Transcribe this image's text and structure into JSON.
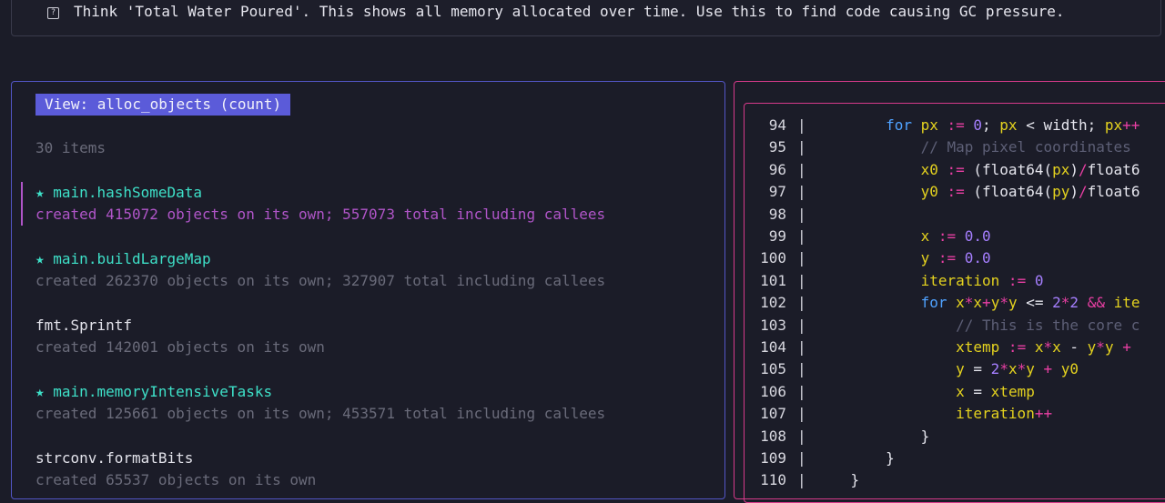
{
  "tip": {
    "icon": "question-square-icon",
    "text": "Think 'Total Water Poured'. This shows all memory allocated over time. Use this to find code causing GC pressure."
  },
  "view": {
    "label": "View: alloc_objects (count)",
    "item_count": "30 items"
  },
  "items": [
    {
      "star": "★",
      "name": "main.hashSomeData",
      "desc": "created 415072 objects on its own; 557073 total including callees",
      "selected": true
    },
    {
      "star": "★",
      "name": "main.buildLargeMap",
      "desc": "created 262370 objects on its own; 327907 total including callees"
    },
    {
      "star": "",
      "name": "fmt.Sprintf",
      "desc": "created 142001 objects on its own"
    },
    {
      "star": "★",
      "name": "main.memoryIntensiveTasks",
      "desc": "created 125661 objects on its own; 453571 total including callees"
    },
    {
      "star": "",
      "name": "strconv.formatBits",
      "desc": "created 65537 objects on its own"
    }
  ],
  "code": {
    "separator": "|",
    "lines": [
      {
        "num": "94",
        "tokens": [
          [
            "pl",
            "        "
          ],
          [
            "kw",
            "for "
          ],
          [
            "id",
            "px"
          ],
          [
            "op",
            " := "
          ],
          [
            "num",
            "0"
          ],
          [
            "pl",
            "; "
          ],
          [
            "id",
            "px"
          ],
          [
            "pl",
            " < "
          ],
          [
            "pl",
            "width"
          ],
          [
            "pl",
            "; "
          ],
          [
            "id",
            "px"
          ],
          [
            "op",
            "++"
          ]
        ]
      },
      {
        "num": "95",
        "tokens": [
          [
            "pl",
            "            "
          ],
          [
            "cm",
            "// Map pixel coordinates "
          ]
        ]
      },
      {
        "num": "96",
        "tokens": [
          [
            "pl",
            "            "
          ],
          [
            "id",
            "x0"
          ],
          [
            "op",
            " := "
          ],
          [
            "pl",
            "("
          ],
          [
            "pl",
            "float64"
          ],
          [
            "pl",
            "("
          ],
          [
            "id",
            "px"
          ],
          [
            "pl",
            ")"
          ],
          [
            "op",
            "/"
          ],
          [
            "pl",
            "float6"
          ]
        ]
      },
      {
        "num": "97",
        "tokens": [
          [
            "pl",
            "            "
          ],
          [
            "id",
            "y0"
          ],
          [
            "op",
            " := "
          ],
          [
            "pl",
            "("
          ],
          [
            "pl",
            "float64"
          ],
          [
            "pl",
            "("
          ],
          [
            "id",
            "py"
          ],
          [
            "pl",
            ")"
          ],
          [
            "op",
            "/"
          ],
          [
            "pl",
            "float6"
          ]
        ]
      },
      {
        "num": "98",
        "tokens": []
      },
      {
        "num": "99",
        "tokens": [
          [
            "pl",
            "            "
          ],
          [
            "id",
            "x"
          ],
          [
            "op",
            " := "
          ],
          [
            "num",
            "0.0"
          ]
        ]
      },
      {
        "num": "100",
        "tokens": [
          [
            "pl",
            "            "
          ],
          [
            "id",
            "y"
          ],
          [
            "op",
            " := "
          ],
          [
            "num",
            "0.0"
          ]
        ]
      },
      {
        "num": "101",
        "tokens": [
          [
            "pl",
            "            "
          ],
          [
            "id",
            "iteration"
          ],
          [
            "op",
            " := "
          ],
          [
            "num",
            "0"
          ]
        ]
      },
      {
        "num": "102",
        "tokens": [
          [
            "pl",
            "            "
          ],
          [
            "kw",
            "for "
          ],
          [
            "id",
            "x"
          ],
          [
            "op",
            "*"
          ],
          [
            "id",
            "x"
          ],
          [
            "op",
            "+"
          ],
          [
            "id",
            "y"
          ],
          [
            "op",
            "*"
          ],
          [
            "id",
            "y"
          ],
          [
            "pl",
            " <= "
          ],
          [
            "num",
            "2"
          ],
          [
            "op",
            "*"
          ],
          [
            "num",
            "2"
          ],
          [
            "op",
            " && "
          ],
          [
            "id",
            "ite"
          ]
        ]
      },
      {
        "num": "103",
        "tokens": [
          [
            "pl",
            "                "
          ],
          [
            "cm",
            "// This is the core c"
          ]
        ]
      },
      {
        "num": "104",
        "tokens": [
          [
            "pl",
            "                "
          ],
          [
            "id",
            "xtemp"
          ],
          [
            "op",
            " := "
          ],
          [
            "id",
            "x"
          ],
          [
            "op",
            "*"
          ],
          [
            "id",
            "x"
          ],
          [
            "pl",
            " - "
          ],
          [
            "id",
            "y"
          ],
          [
            "op",
            "*"
          ],
          [
            "id",
            "y"
          ],
          [
            "op",
            " + "
          ]
        ]
      },
      {
        "num": "105",
        "tokens": [
          [
            "pl",
            "                "
          ],
          [
            "id",
            "y"
          ],
          [
            "pl",
            " = "
          ],
          [
            "num",
            "2"
          ],
          [
            "op",
            "*"
          ],
          [
            "id",
            "x"
          ],
          [
            "op",
            "*"
          ],
          [
            "id",
            "y"
          ],
          [
            "op",
            " + "
          ],
          [
            "id",
            "y0"
          ]
        ]
      },
      {
        "num": "106",
        "tokens": [
          [
            "pl",
            "                "
          ],
          [
            "id",
            "x"
          ],
          [
            "pl",
            " = "
          ],
          [
            "id",
            "xtemp"
          ]
        ]
      },
      {
        "num": "107",
        "tokens": [
          [
            "pl",
            "                "
          ],
          [
            "id",
            "iteration"
          ],
          [
            "op",
            "++"
          ]
        ]
      },
      {
        "num": "108",
        "tokens": [
          [
            "pl",
            "            "
          ],
          [
            "pl",
            "}"
          ]
        ]
      },
      {
        "num": "109",
        "tokens": [
          [
            "pl",
            "        "
          ],
          [
            "pl",
            "}"
          ]
        ]
      },
      {
        "num": "110",
        "tokens": [
          [
            "pl",
            "    "
          ],
          [
            "pl",
            "}"
          ]
        ]
      }
    ]
  }
}
